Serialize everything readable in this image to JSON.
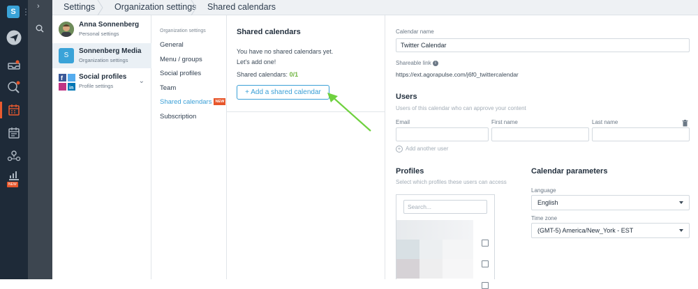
{
  "rail": {
    "workspace_initial": "S",
    "new_badge": "NEW",
    "colors": {
      "bg": "#1e2a38",
      "active": "#ea5b2f"
    },
    "icons": [
      "paper-plane-icon",
      "inbox-icon",
      "listening-icon",
      "calendar-icon",
      "schedule-icon",
      "team-icon",
      "reports-icon"
    ]
  },
  "breadcrumb": [
    "Settings",
    "Organization settings",
    "Shared calendars"
  ],
  "accounts": [
    {
      "name": "Anna Sonnenberg",
      "sub": "Personal settings",
      "icon": "user-avatar"
    },
    {
      "name": "Sonnenberg Media",
      "sub": "Organization settings",
      "initial": "S"
    },
    {
      "name": "Social profiles",
      "sub": "Profile settings",
      "icon": "social-profile-avatars"
    }
  ],
  "menu": {
    "heading": "Organization settings",
    "items": [
      "General",
      "Menu / groups",
      "Social profiles",
      "Team",
      "Shared calendars",
      "Subscription"
    ],
    "new_badge": "NEW"
  },
  "list": {
    "title": "Shared calendars",
    "empty_line1": "You have no shared calendars yet.",
    "empty_line2": "Let's add one!",
    "count_label": "Shared calendars:",
    "count_value": "0/1",
    "add_button": "+ Add a shared calendar"
  },
  "detail": {
    "calendar_name_label": "Calendar name",
    "calendar_name_value": "Twitter Calendar",
    "shareable_link_label": "Shareable link",
    "shareable_link_value": "https://ext.agorapulse.com/j6f0_twittercalendar",
    "users_heading": "Users",
    "users_hint": "Users of this calendar who can approve your content",
    "email_label": "Email",
    "first_name_label": "First name",
    "last_name_label": "Last name",
    "add_user": "Add another user",
    "profiles_heading": "Profiles",
    "profiles_hint": "Select which profiles these users can access",
    "profiles_search_placeholder": "Search...",
    "params_heading": "Calendar parameters",
    "language_label": "Language",
    "language_value": "English",
    "timezone_label": "Time zone",
    "timezone_value": "(GMT-5) America/New_York - EST"
  },
  "accent": "#3a9fd6",
  "annotation_color": "#6fd13f"
}
